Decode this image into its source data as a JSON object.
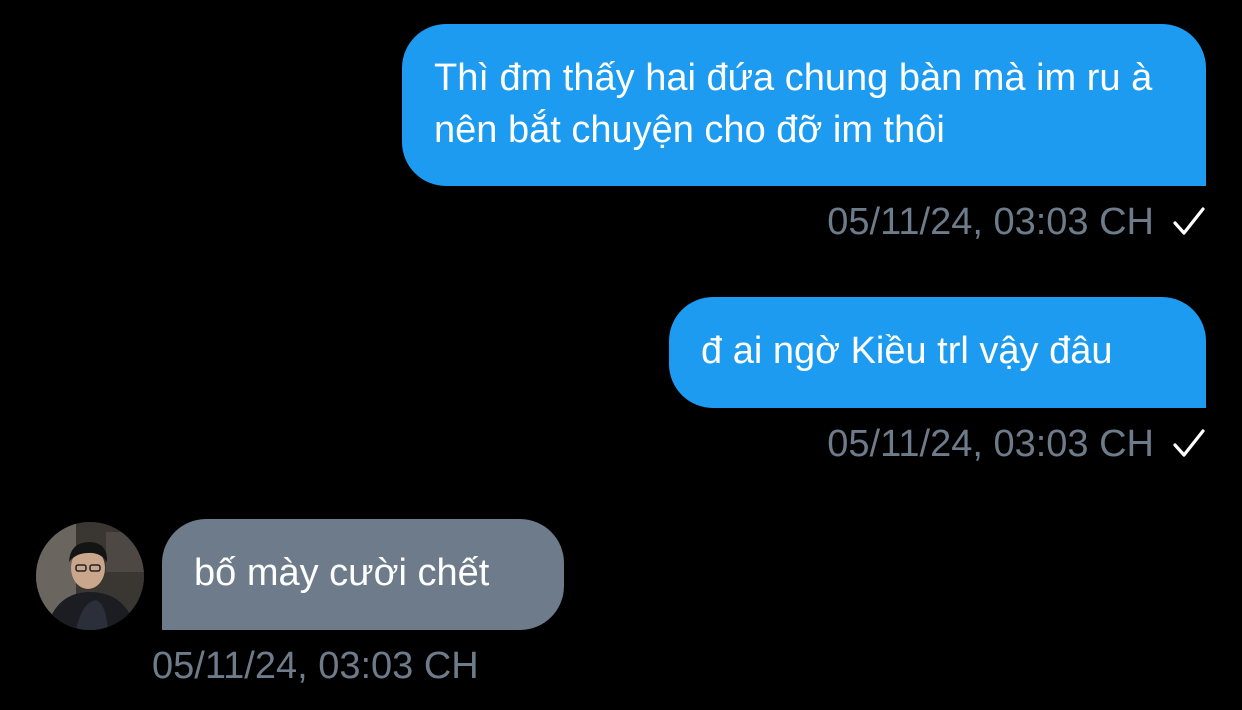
{
  "messages": [
    {
      "direction": "outgoing",
      "text": "Thì đm thấy hai đứa chung bàn mà im ru à nên bắt chuyện cho đỡ im thôi",
      "timestamp": "05/11/24, 03:03 CH",
      "status_icon": "checkmark-icon"
    },
    {
      "direction": "outgoing",
      "text": "đ ai ngờ Kiều trl vậy đâu",
      "timestamp": "05/11/24, 03:03 CH",
      "status_icon": "checkmark-icon"
    },
    {
      "direction": "incoming",
      "text": "bố mày cười chết",
      "timestamp": "05/11/24, 03:03 CH",
      "sender_avatar": "user-avatar"
    }
  ],
  "colors": {
    "background": "#000000",
    "outgoing_bubble": "#1d9bf0",
    "incoming_bubble": "#6e7b8a",
    "timestamp_text": "#6e7b8a",
    "message_text": "#ffffff"
  }
}
